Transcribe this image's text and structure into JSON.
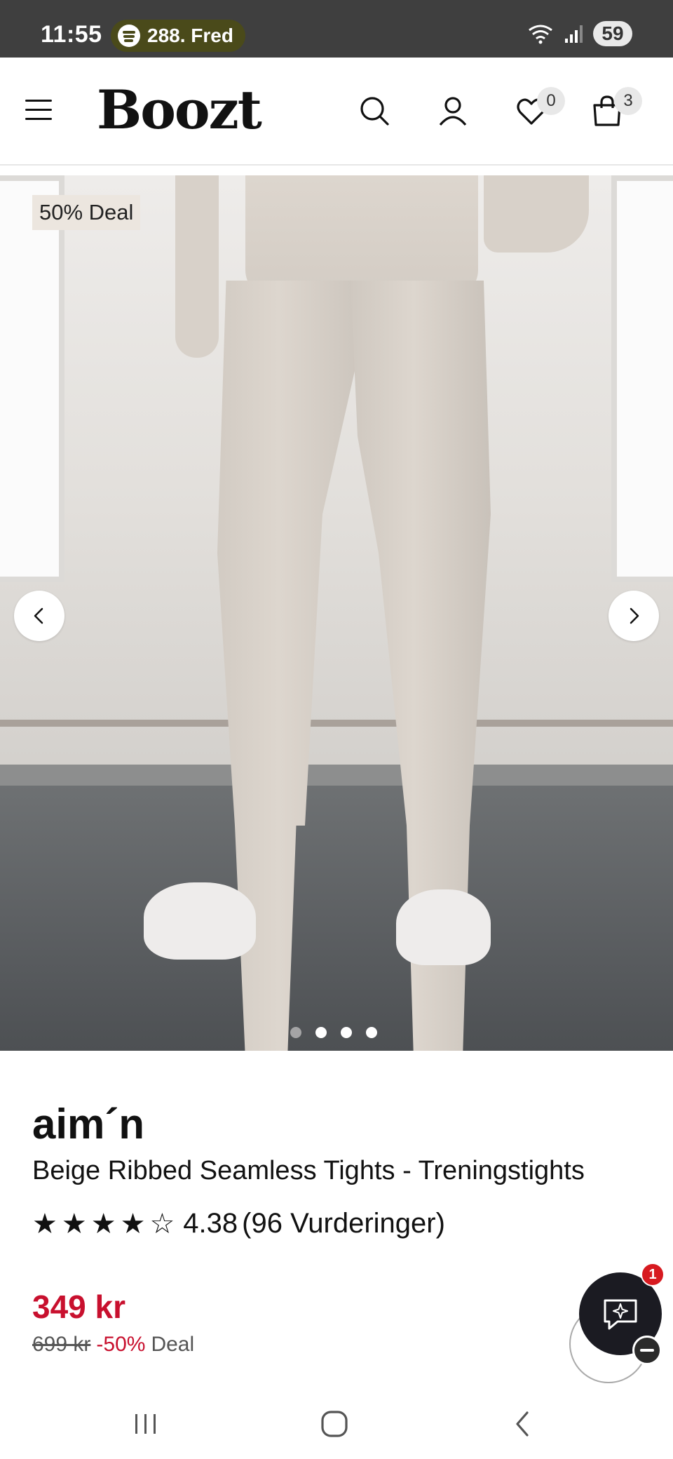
{
  "status_bar": {
    "time": "11:55",
    "media_text": "288. Fred",
    "battery": "59"
  },
  "header": {
    "logo": "Boozt",
    "wishlist_count": "0",
    "cart_count": "3"
  },
  "gallery": {
    "deal_badge": "50% Deal",
    "total_images": 4,
    "active_index": 1
  },
  "product": {
    "brand": "aim´n",
    "title": "Beige Ribbed Seamless Tights - Treningstights",
    "rating_value": "4.38",
    "rating_count_text": "(96 Vurderinger)",
    "stars_filled": 4,
    "stars_total": 5
  },
  "pricing": {
    "price": "349 kr",
    "old_price": "699 kr",
    "discount": "-50%",
    "deal_label": "Deal",
    "accent_color": "#c8102e"
  },
  "chat": {
    "badge_count": "1"
  }
}
